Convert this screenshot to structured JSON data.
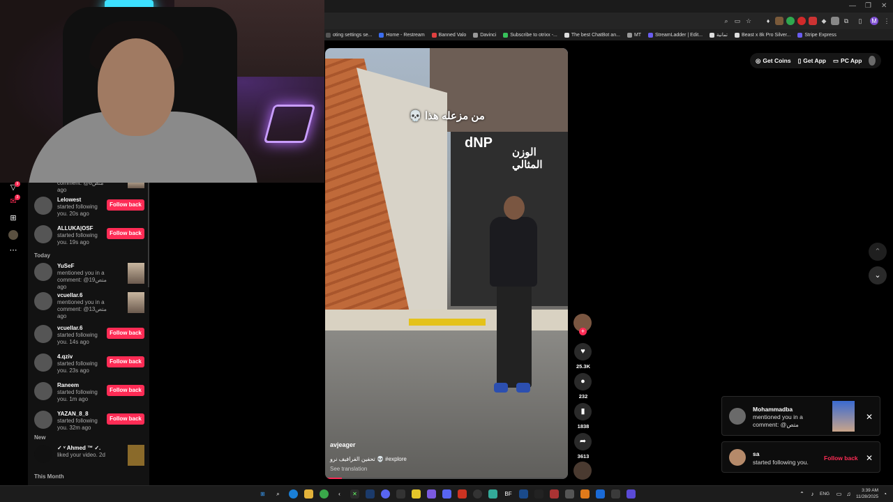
{
  "browser": {
    "bookmarks": [
      {
        "label": "oting settings se...",
        "color": "#555"
      },
      {
        "label": "Home - Restream",
        "color": "#3b6df0"
      },
      {
        "label": "Banned Valo",
        "color": "#e04040"
      },
      {
        "label": "Davinci",
        "color": "#999"
      },
      {
        "label": "Subscribe to otrixx -...",
        "color": "#37c15a"
      },
      {
        "label": "The best ChatBot an...",
        "color": "#ddd"
      },
      {
        "label": "MT",
        "color": "#999"
      },
      {
        "label": "StreamLadder | Edit...",
        "color": "#6a5df0"
      },
      {
        "label": "تمانية",
        "color": "#ddd"
      },
      {
        "label": "Beast x 8k Pro Silver...",
        "color": "#ddd"
      },
      {
        "label": "Stripe Express",
        "color": "#6a5df0"
      }
    ],
    "profile_initial": "M"
  },
  "header": {
    "get_coins": "Get Coins",
    "get_app": "Get App",
    "pc_app": "PC App"
  },
  "rail": {
    "badges": {
      "activity": "9",
      "messages": "3"
    }
  },
  "notifications": {
    "top_partial": {
      "text": "comment: @متص8 ago"
    },
    "items_a": [
      {
        "name": "Lelowest",
        "text": "started following you. 20s ago",
        "action": "Follow back"
      },
      {
        "name": "ALLUKA|OSF",
        "text": "started following you. 19s ago",
        "action": "Follow back"
      }
    ],
    "section_today": "Today",
    "items_b": [
      {
        "name": "YuSeF",
        "text": "mentioned you in a comment: @متص19 ago"
      },
      {
        "name": "vcuellar.6",
        "text": "mentioned you in a comment: @متص13 ago"
      }
    ],
    "items_c": [
      {
        "name": "vcuellar.6",
        "text": "started following you. 14s ago",
        "action": "Follow back"
      },
      {
        "name": "4.qziv",
        "text": "started following you. 23s ago",
        "action": "Follow back"
      },
      {
        "name": "Raneem",
        "text": "started following you. 1m ago",
        "action": "Follow back"
      },
      {
        "name": "YAZAN_8_8",
        "text": "started following you. 32m ago",
        "action": "Follow back"
      }
    ],
    "section_new": "New",
    "item_new": {
      "name": "✓ ᵛ Ahmed ™ ✓.",
      "text": "liked your video. 2d"
    },
    "section_month": "This Month"
  },
  "video": {
    "caption": "من مزعله هذا 💀",
    "store_sign_latin": "dNP",
    "store_sign_arabic": "الوزن المثالي",
    "author": "avjeager",
    "description": "تحفين الفرافيف نرو 💀 #explore",
    "translate": "See translation",
    "progress": 0.07
  },
  "actions": {
    "likes": "25.3K",
    "comments": "232",
    "saves": "1838",
    "shares": "3613"
  },
  "toasts": {
    "mention": {
      "name": "Mohammadba",
      "text": "mentioned you in a comment: @متص"
    },
    "follow": {
      "name": "sa",
      "text": "started following you.",
      "action": "Follow back"
    }
  },
  "taskbar": {
    "lang": "ENG",
    "time": "3:39 AM",
    "date": "11/28/2025"
  }
}
